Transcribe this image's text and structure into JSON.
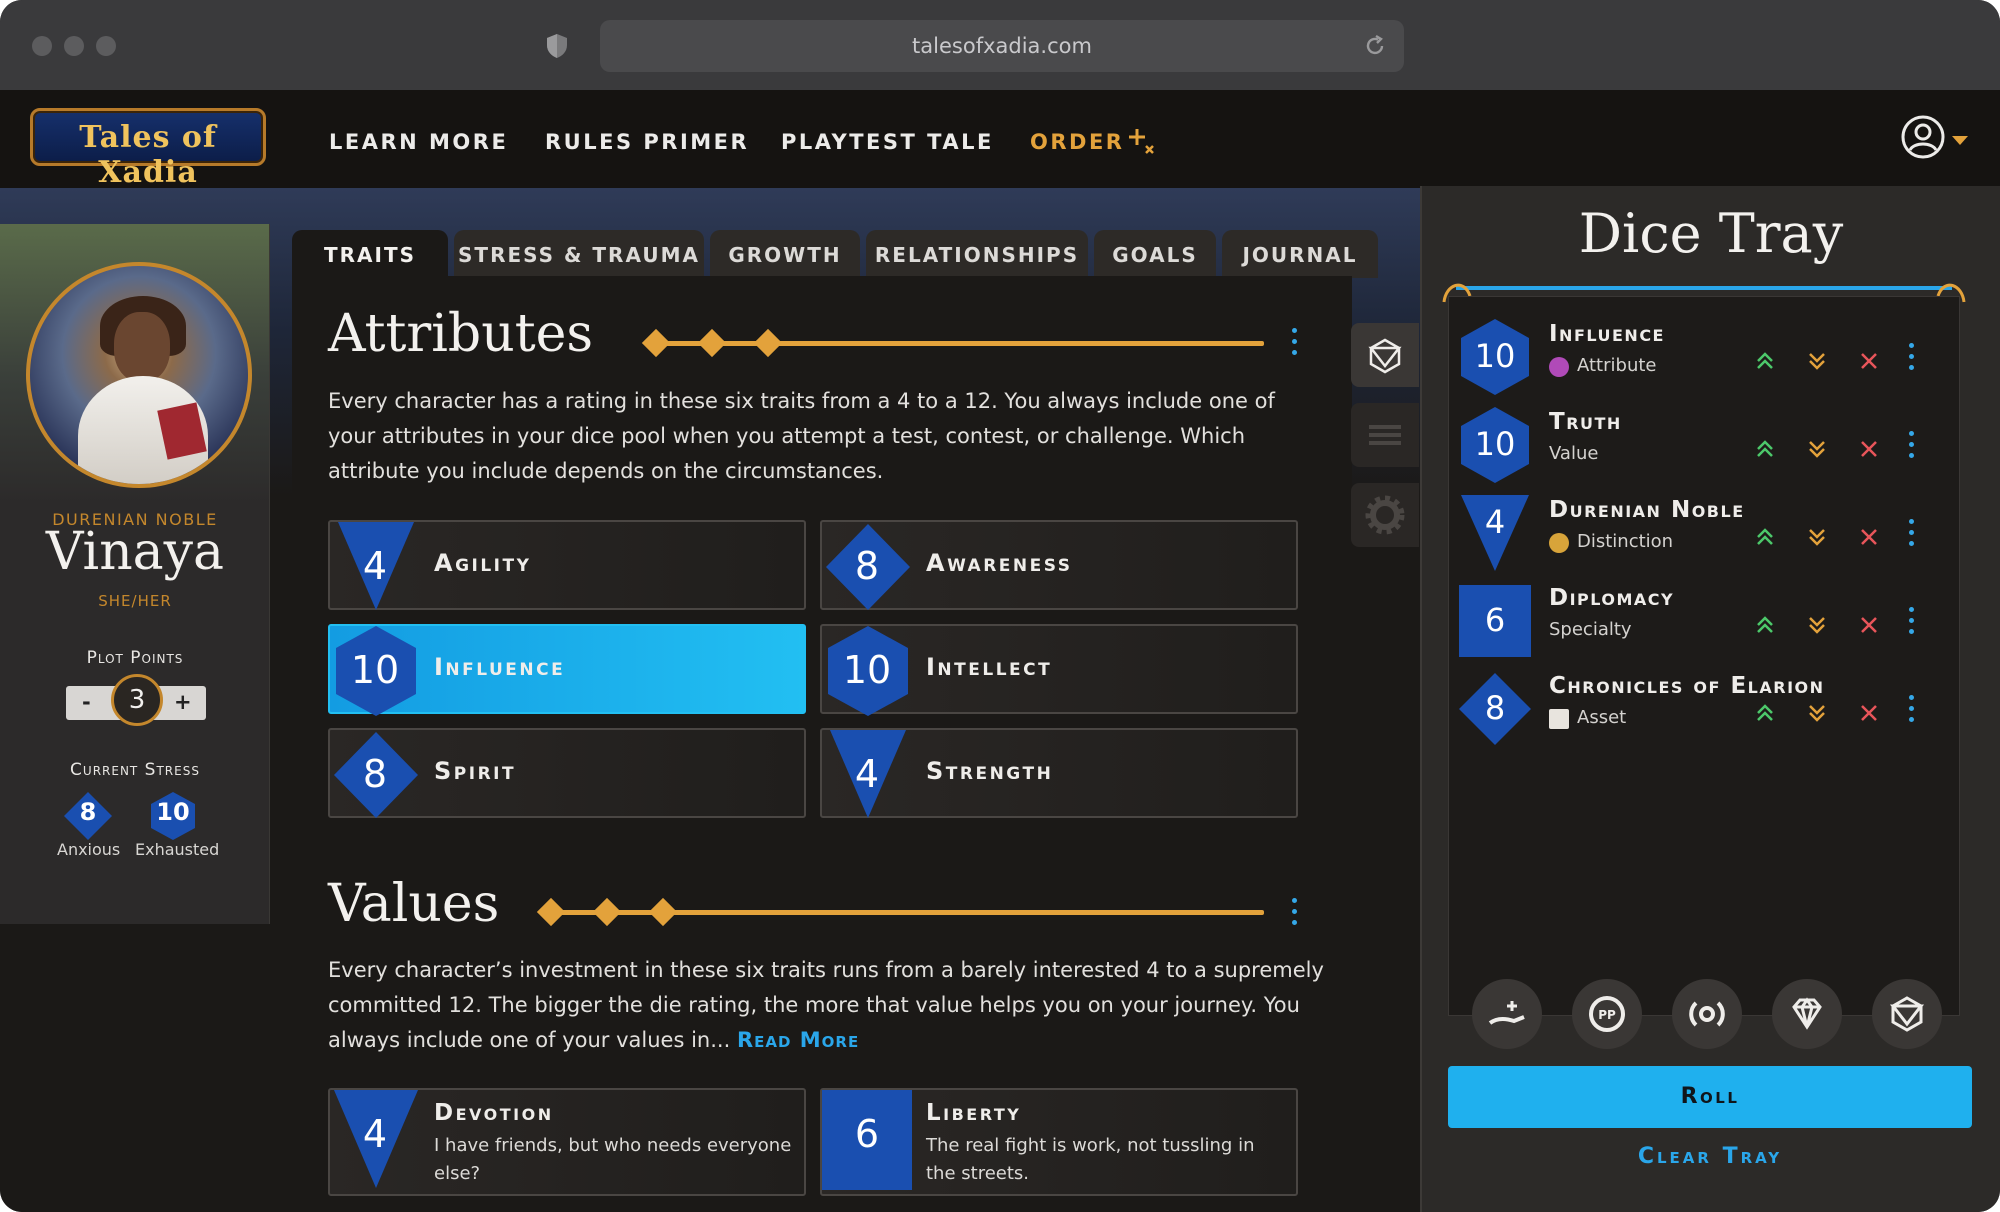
{
  "browser": {
    "url": "talesofxadia.com"
  },
  "nav": {
    "logo_text": "Tales of Xadia",
    "links": [
      "LEARN MORE",
      "RULES PRIMER",
      "PLAYTEST TALE",
      "ORDER"
    ]
  },
  "character": {
    "ancestry": "DURENIAN NOBLE",
    "name": "Vinaya",
    "pronouns": "SHE/HER",
    "plot_points_label": "Plot Points",
    "plot_points_minus": "-",
    "plot_points": "3",
    "plot_points_plus": "+",
    "stress_label": "Current Stress",
    "stress": [
      {
        "value": "8",
        "label": "Anxious"
      },
      {
        "value": "10",
        "label": "Exhausted"
      }
    ]
  },
  "tabs": [
    "TRAITS",
    "STRESS & TRAUMA",
    "GROWTH",
    "RELATIONSHIPS",
    "GOALS",
    "JOURNAL"
  ],
  "attributes": {
    "title": "Attributes",
    "description": "Every character has a rating in these six traits from a 4 to a 12. You always include one of your attributes in your dice pool when you attempt a test, contest, or challenge. Which attribute you include depends on the circumstances.",
    "items": [
      {
        "die": "4",
        "name": "Agility"
      },
      {
        "die": "8",
        "name": "Awareness"
      },
      {
        "die": "10",
        "name": "Influence"
      },
      {
        "die": "10",
        "name": "Intellect"
      },
      {
        "die": "8",
        "name": "Spirit"
      },
      {
        "die": "4",
        "name": "Strength"
      }
    ]
  },
  "values": {
    "title": "Values",
    "description": "Every character’s investment in these six traits runs from a barely interested 4 to a supremely committed 12. The bigger the die rating, the more that value helps you on your journey. You always include one of your values in...",
    "read_more": "Read More",
    "items": [
      {
        "die": "4",
        "name": "Devotion",
        "statement": "I have friends, but who needs everyone else?"
      },
      {
        "die": "6",
        "name": "Liberty",
        "statement": "The real fight is work, not tussling in the streets."
      }
    ]
  },
  "dice_tray": {
    "title": "Dice Tray",
    "items": [
      {
        "die": "10",
        "name": "Influence",
        "type": "Attribute"
      },
      {
        "die": "10",
        "name": "Truth",
        "type": "Value"
      },
      {
        "die": "4",
        "name": "Durenian Noble",
        "type": "Distinction"
      },
      {
        "die": "6",
        "name": "Diplomacy",
        "type": "Specialty"
      },
      {
        "die": "8",
        "name": "Chronicles of Elarion",
        "type": "Asset"
      }
    ],
    "roll_label": "Roll",
    "clear_label": "Clear Tray"
  },
  "icons": {
    "window_controls": "traffic-light-icons",
    "shield": "privacy-shield-icon",
    "reload": "reload-icon",
    "order_sparkle": "sparkle-icon",
    "user": "user-account-icon",
    "rail": [
      "d20-dice-icon",
      "list-icon",
      "gear-icon"
    ],
    "tray_buttons": [
      "hand-sparkle-icon",
      "plot-point-icon",
      "resonance-icon",
      "gem-icon",
      "d20-dice-icon"
    ]
  },
  "colors": {
    "accent_gold": "#e3a23b",
    "accent_blue": "#1fb0ee",
    "die_blue": "#1a4fb0",
    "up_green": "#4cc86a",
    "down_orange": "#e3a23b",
    "remove_red": "#e8555a"
  }
}
